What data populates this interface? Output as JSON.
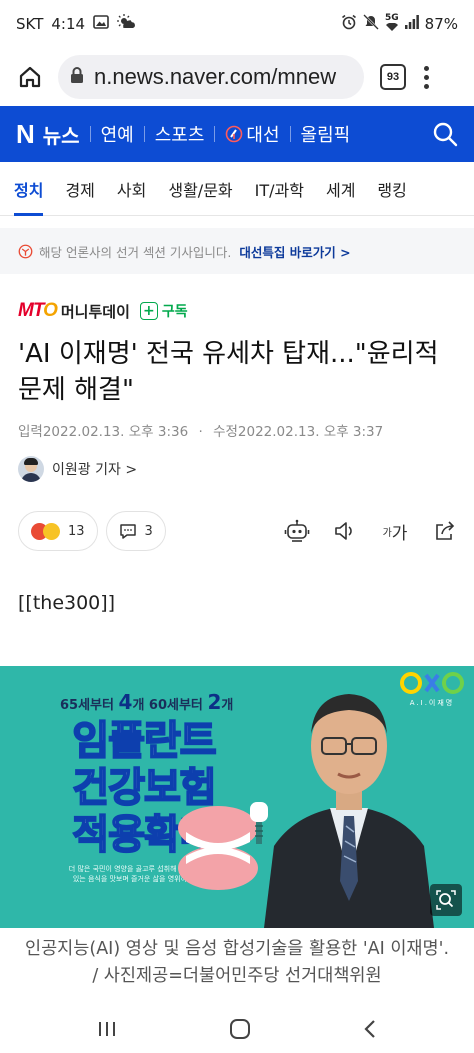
{
  "status_bar": {
    "carrier": "SKT",
    "time": "4:14",
    "network": "5G",
    "battery": "87%"
  },
  "browser": {
    "url": "n.news.naver.com/mnew",
    "tab_count": "93"
  },
  "naver_header": {
    "logo": "N",
    "section": "뉴스",
    "links": [
      {
        "label": "연예"
      },
      {
        "label": "스포츠"
      },
      {
        "label": "대선",
        "icon": "election-icon"
      },
      {
        "label": "올림픽"
      }
    ]
  },
  "categories": [
    {
      "label": "정치",
      "active": true
    },
    {
      "label": "경제"
    },
    {
      "label": "사회"
    },
    {
      "label": "생활/문화"
    },
    {
      "label": "IT/과학"
    },
    {
      "label": "세계"
    },
    {
      "label": "랭킹"
    }
  ],
  "notice": {
    "text": "해당 언론사의 선거 섹션 기사입니다.",
    "link": "대선특집 바로가기",
    "link_arrow": ">"
  },
  "press": {
    "logo_main": "MT",
    "logo_o": "O",
    "name": "머니투데이",
    "subscribe_plus": "+",
    "subscribe_label": "구독"
  },
  "article": {
    "headline": "'AI 이재명' 전국 유세차 탑재...\"윤리적 문제 해결\"",
    "input_date": "입력2022.02.13. 오후 3:36",
    "modified_date": "수정2022.02.13. 오후 3:37",
    "reporter": "이원광 기자",
    "reporter_arrow": ">",
    "reaction_count": "13",
    "comment_count": "3",
    "font_tool_small": "가",
    "font_tool_big": "가",
    "body_first_line": "[[the300]]",
    "caption": "인공지능(AI) 영상 및 음성 합성기술을 활용한 'AI 이재명'. / 사진제공=더불어민주당 선거대책위원"
  },
  "photo": {
    "sub_line_parts": [
      "65세부터",
      "4",
      "개 60세부터",
      "2",
      "개"
    ],
    "title_lines": [
      "임플란트",
      "건강보험",
      "적용확대"
    ],
    "small_text": "더 많은 국민이 영양을 골고루 섭취해 건강하고 맛있는 음식을 맛보며 즐거운 삶을 영위하시도록!",
    "logo_sub": "A.I.이재명"
  },
  "colors": {
    "naver_blue": "#0d4cd3",
    "subscribe_green": "#03a94d",
    "photo_bg": "#2fb7a9"
  }
}
